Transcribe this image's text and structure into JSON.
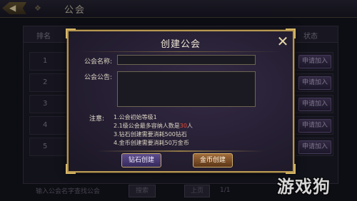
{
  "top_bar": {
    "title": "公会"
  },
  "background_table": {
    "header_rank": "排名",
    "header_status": "状态",
    "rows": [
      {
        "num": "1",
        "action": "申请加入"
      },
      {
        "num": "2",
        "action": "申请加入"
      },
      {
        "num": "3",
        "action": "申请加入"
      },
      {
        "num": "4",
        "action": "申请加入"
      },
      {
        "num": "5",
        "action": "申请加入"
      }
    ],
    "bottom_text": "输入公会名字查找公会",
    "bottom_search": "搜索",
    "bottom_page": "1/1",
    "bottom_prev": "上页"
  },
  "dialog": {
    "title": "创建公会",
    "close_symbol": "✕",
    "name_label": "公会名称:",
    "name_value": "",
    "notice_label": "公会公告:",
    "notice_value": "",
    "notes_label": "注意:",
    "notes": [
      {
        "pre": "1.公会初始等级1",
        "hl": "",
        "post": ""
      },
      {
        "pre": "2.1级公会最多容纳人数是",
        "hl": "30",
        "post": "人"
      },
      {
        "pre": "3.钻石创建需要消耗500钻石",
        "hl": "",
        "post": ""
      },
      {
        "pre": "4.金币创建需要消耗50万金币",
        "hl": "",
        "post": ""
      }
    ],
    "diamond_button": "钻石创建",
    "gold_button": "金币创建"
  },
  "watermark": {
    "text": "游戏狗"
  },
  "colors": {
    "accent_gold": "#b79852",
    "highlight_red": "#e34a36"
  }
}
